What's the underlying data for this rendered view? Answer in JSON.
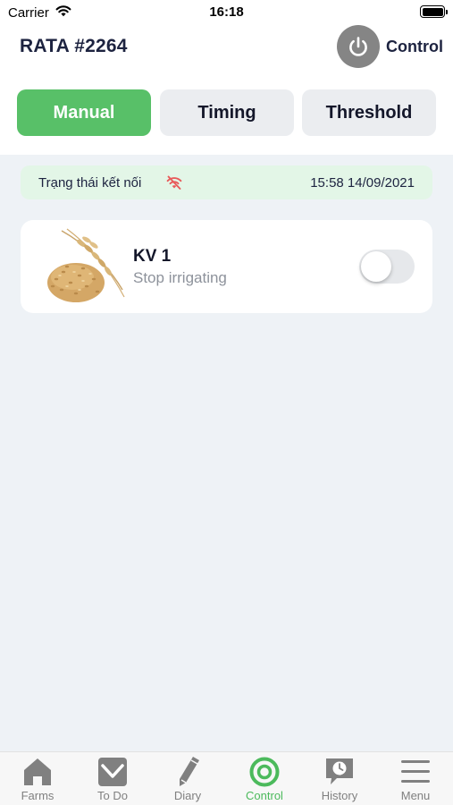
{
  "status_bar": {
    "carrier": "Carrier",
    "time": "16:18"
  },
  "header": {
    "title": "RATA #2264",
    "control_label": "Control",
    "power_icon": "power-icon"
  },
  "mode_tabs": [
    {
      "label": "Manual",
      "active": true
    },
    {
      "label": "Timing",
      "active": false
    },
    {
      "label": "Threshold",
      "active": false
    }
  ],
  "connection": {
    "label": "Trạng thái kết nối",
    "icon": "wifi-off-icon",
    "timestamp": "15:58 14/09/2021"
  },
  "zones": [
    {
      "name": "KV 1",
      "status": "Stop irrigating",
      "image": "wheat-grain-image",
      "switch_on": false
    }
  ],
  "bottom_nav": [
    {
      "label": "Farms",
      "icon": "home-icon",
      "active": false
    },
    {
      "label": "To Do",
      "icon": "checkbox-icon",
      "active": false
    },
    {
      "label": "Diary",
      "icon": "pencil-icon",
      "active": false
    },
    {
      "label": "Control",
      "icon": "target-icon",
      "active": true
    },
    {
      "label": "History",
      "icon": "history-icon",
      "active": false
    },
    {
      "label": "Menu",
      "icon": "menu-icon",
      "active": false
    }
  ],
  "colors": {
    "accent_green": "#58c068",
    "nav_active_green": "#4cba5c",
    "connection_bg": "#e3f6e7",
    "wifi_off_red": "#e85a5a",
    "power_button_gray": "#858585"
  }
}
